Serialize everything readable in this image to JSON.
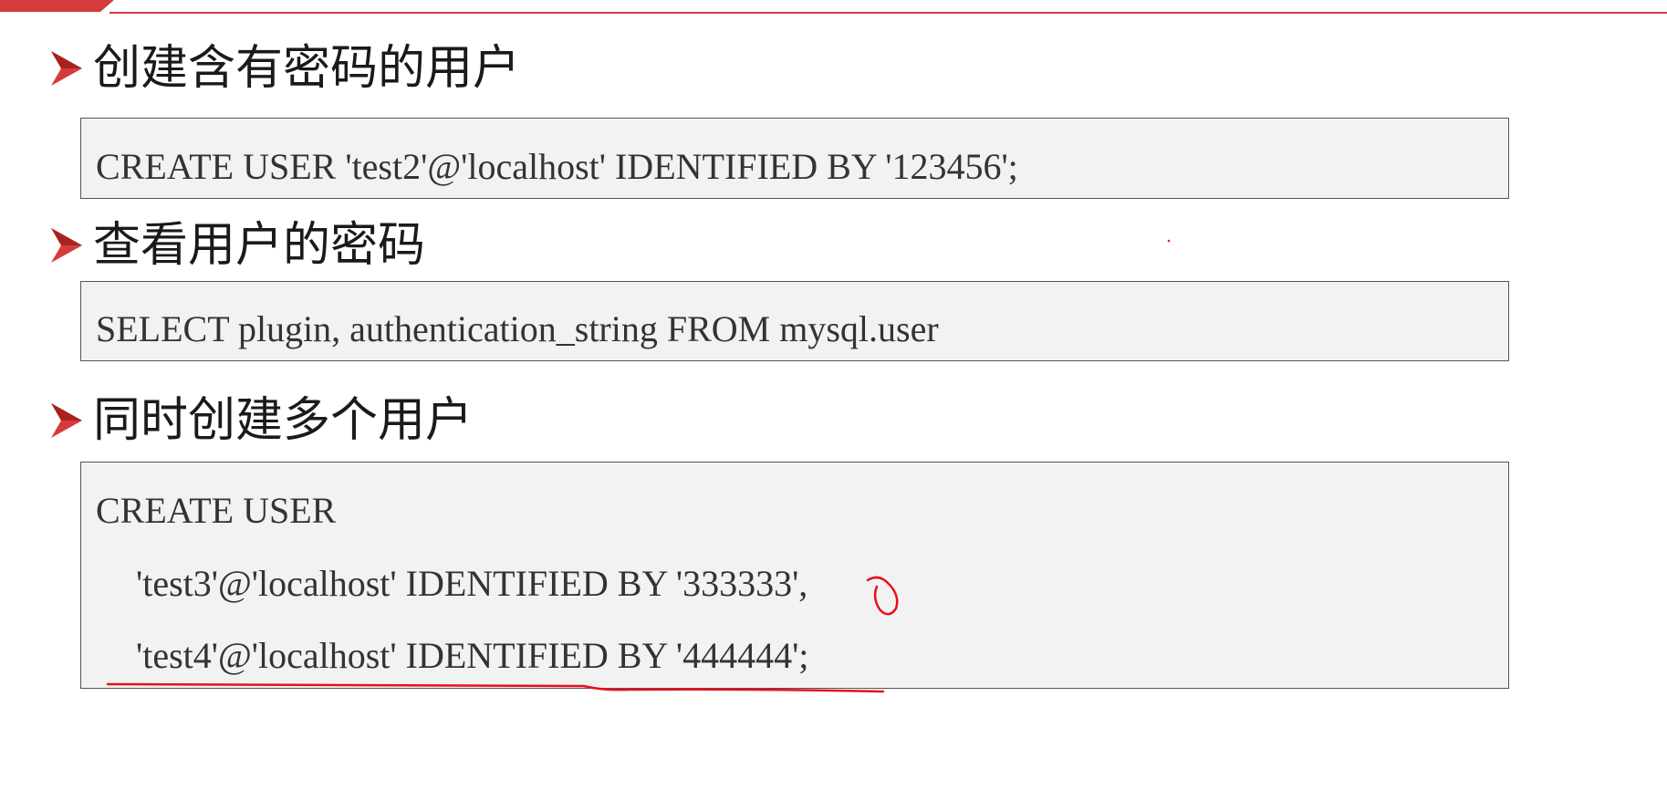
{
  "sections": [
    {
      "heading": "创建含有密码的用户",
      "code": [
        "CREATE USER 'test2'@'localhost' IDENTIFIED BY '123456';"
      ]
    },
    {
      "heading": "查看用户的密码",
      "code": [
        "SELECT plugin, authentication_string FROM mysql.user"
      ]
    },
    {
      "heading": "同时创建多个用户",
      "code": [
        "CREATE USER",
        "'test3'@'localhost' IDENTIFIED BY '333333',",
        "'test4'@'localhost' IDENTIFIED BY '444444';"
      ]
    }
  ],
  "colors": {
    "accent": "#d63b3b",
    "annotation": "#e8101a",
    "code_bg": "#f2f2f2",
    "code_border": "#555555"
  }
}
